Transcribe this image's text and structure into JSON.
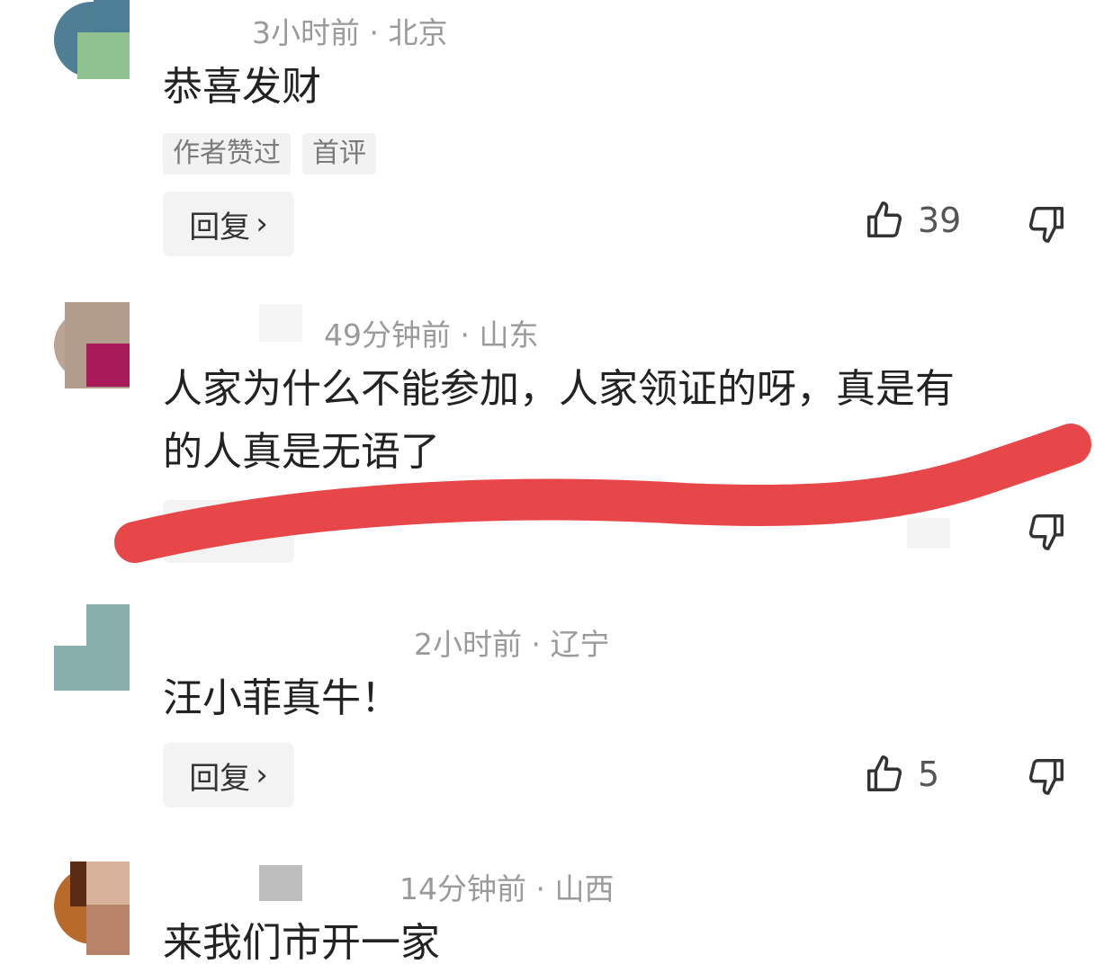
{
  "comments": [
    {
      "time_location": "3小时前 · 北京",
      "text": "恭喜发财",
      "tags": [
        "作者赞过",
        "首评"
      ],
      "reply_label": "回复",
      "like_count": "39"
    },
    {
      "time_location": "49分钟前 · 山东",
      "text_line1": "人家为什么不能参加，人家领证的呀，真是有",
      "text_line2": "的人真是无语了"
    },
    {
      "time_location": "2小时前 · 辽宁",
      "text": "汪小菲真牛！",
      "reply_label": "回复",
      "like_count": "5"
    },
    {
      "time_location": "14分钟前 · 山西",
      "text": "来我们市开一家"
    }
  ],
  "icons": {
    "like": "thumbs-up-icon",
    "dislike": "thumbs-down-icon",
    "reply_chevron": "chevron-right-icon"
  },
  "colors": {
    "annotation_stroke": "#e8474a",
    "meta_text": "#9a9a9a",
    "button_bg": "#f3f3f3"
  }
}
